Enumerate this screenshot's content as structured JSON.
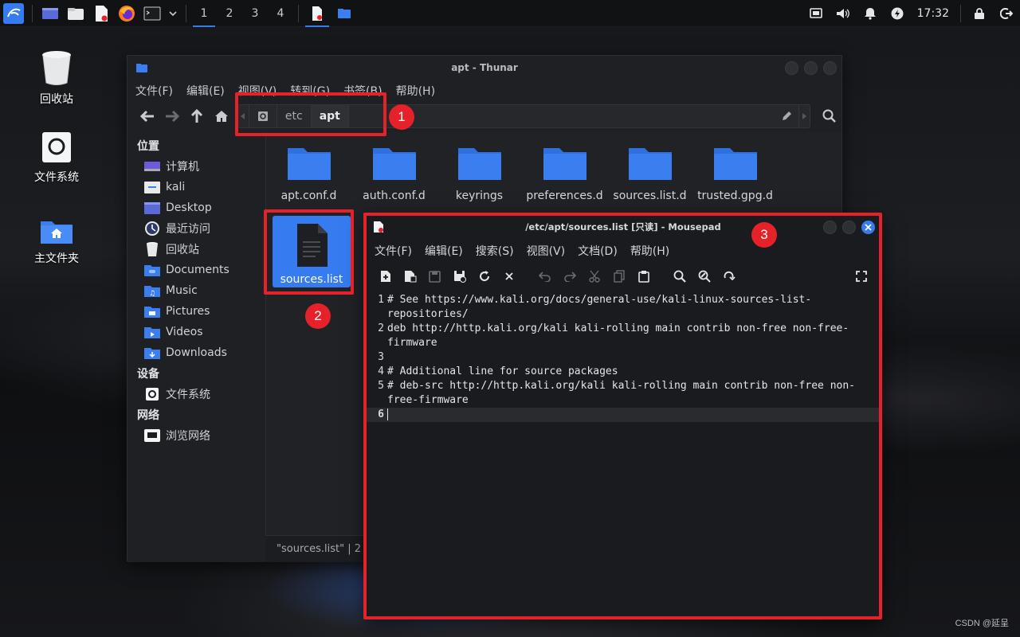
{
  "panel": {
    "workspaces": [
      "1",
      "2",
      "3",
      "4"
    ],
    "active_workspace": "1",
    "clock": "17:32"
  },
  "desktop": {
    "icons": [
      {
        "label": "回收站",
        "icon": "trash-icon"
      },
      {
        "label": "文件系统",
        "icon": "drive-icon"
      },
      {
        "label": "主文件夹",
        "icon": "home-folder-icon"
      }
    ]
  },
  "thunar": {
    "title": "apt - Thunar",
    "menu": [
      "文件(F)",
      "编辑(E)",
      "视图(V)",
      "转到(G)",
      "书签(B)",
      "帮助(H)"
    ],
    "path": [
      "etc",
      "apt"
    ],
    "sidebar": {
      "places_header": "位置",
      "places": [
        {
          "label": "计算机",
          "icon": "computer-icon"
        },
        {
          "label": "kali",
          "icon": "home-icon"
        },
        {
          "label": "Desktop",
          "icon": "desktop-folder-icon"
        },
        {
          "label": "最近访问",
          "icon": "recent-icon"
        },
        {
          "label": "回收站",
          "icon": "trash-icon"
        },
        {
          "label": "Documents",
          "icon": "documents-folder-icon"
        },
        {
          "label": "Music",
          "icon": "music-folder-icon"
        },
        {
          "label": "Pictures",
          "icon": "pictures-folder-icon"
        },
        {
          "label": "Videos",
          "icon": "videos-folder-icon"
        },
        {
          "label": "Downloads",
          "icon": "downloads-folder-icon"
        }
      ],
      "devices_header": "设备",
      "devices": [
        {
          "label": "文件系统",
          "icon": "drive-icon"
        }
      ],
      "network_header": "网络",
      "network": [
        {
          "label": "浏览网络",
          "icon": "network-icon"
        }
      ]
    },
    "files": [
      {
        "name": "apt.conf.d",
        "type": "folder"
      },
      {
        "name": "auth.conf.d",
        "type": "folder"
      },
      {
        "name": "keyrings",
        "type": "folder"
      },
      {
        "name": "preferences.d",
        "type": "folder"
      },
      {
        "name": "sources.list.d",
        "type": "folder"
      },
      {
        "name": "trusted.gpg.d",
        "type": "folder"
      },
      {
        "name": "sources.list",
        "type": "file",
        "selected": true
      }
    ],
    "status": "\"sources.list\" | 2"
  },
  "mousepad": {
    "title": "/etc/apt/sources.list [只读] - Mousepad",
    "menu": [
      "文件(F)",
      "编辑(E)",
      "搜索(S)",
      "视图(V)",
      "文档(D)",
      "帮助(H)"
    ],
    "lines": [
      {
        "no": "1",
        "text": [
          "# See https://www.kali.org/docs/general-use/kali-linux-sources-list-",
          "repositories/"
        ]
      },
      {
        "no": "2",
        "text": [
          "deb http://http.kali.org/kali kali-rolling main contrib non-free non-free-",
          "firmware"
        ]
      },
      {
        "no": "3",
        "text": [
          ""
        ]
      },
      {
        "no": "4",
        "text": [
          "# Additional line for source packages"
        ]
      },
      {
        "no": "5",
        "text": [
          "# deb-src http://http.kali.org/kali kali-rolling main contrib non-free non-",
          "free-firmware"
        ]
      },
      {
        "no": "6",
        "text": [
          ""
        ]
      }
    ]
  },
  "annotations": [
    "1",
    "2",
    "3"
  ],
  "watermark": "CSDN @延呈",
  "colors": {
    "accent": "#367bf0",
    "folder": "#3b7ef0",
    "annotation": "#e5222a"
  }
}
